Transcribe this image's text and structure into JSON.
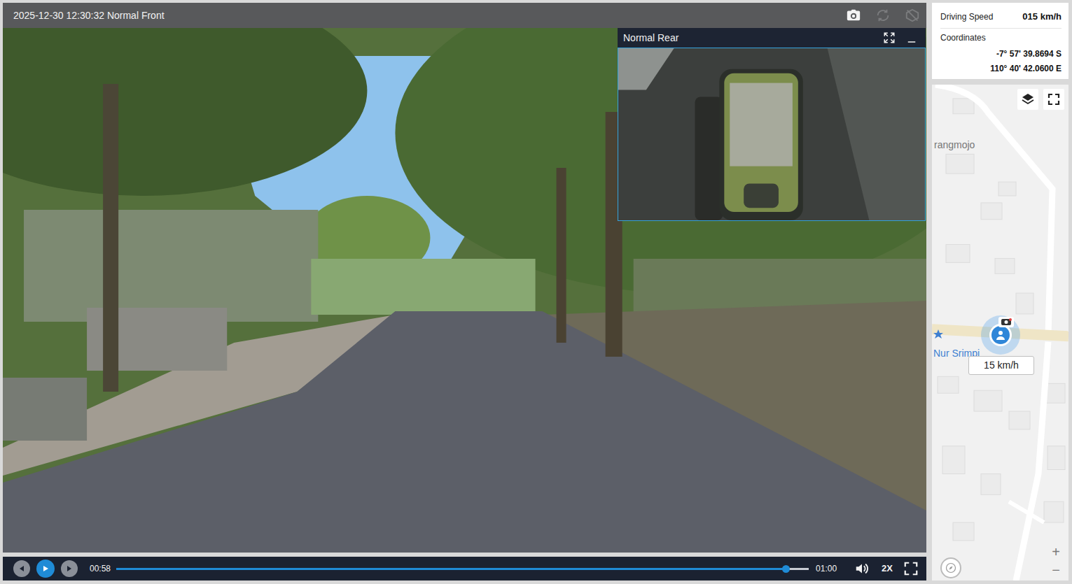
{
  "player": {
    "title": "2025-12-30 12:30:32 Normal Front",
    "snapshot": {
      "disabled": false
    },
    "rotate": {
      "disabled": true
    },
    "privacy": {
      "disabled": true
    }
  },
  "rear": {
    "title": "Normal Rear"
  },
  "controls": {
    "playing": false,
    "elapsed": "00:58",
    "duration": "01:00",
    "level": 0.967,
    "speed": "2X"
  },
  "info": {
    "speed_label": "Driving Speed",
    "speed": "015 km/h",
    "coords_label": "Coordinates",
    "latitude": "-7° 57' 39.8694 S",
    "longitude": "110° 40' 42.0600 E"
  },
  "map": {
    "labels": [
      {
        "text": "rangmojo"
      },
      {
        "text": "Nur Srimpi"
      }
    ],
    "marker_speed": "15 km/h",
    "zoom_in": "+",
    "zoom_out": "−"
  }
}
